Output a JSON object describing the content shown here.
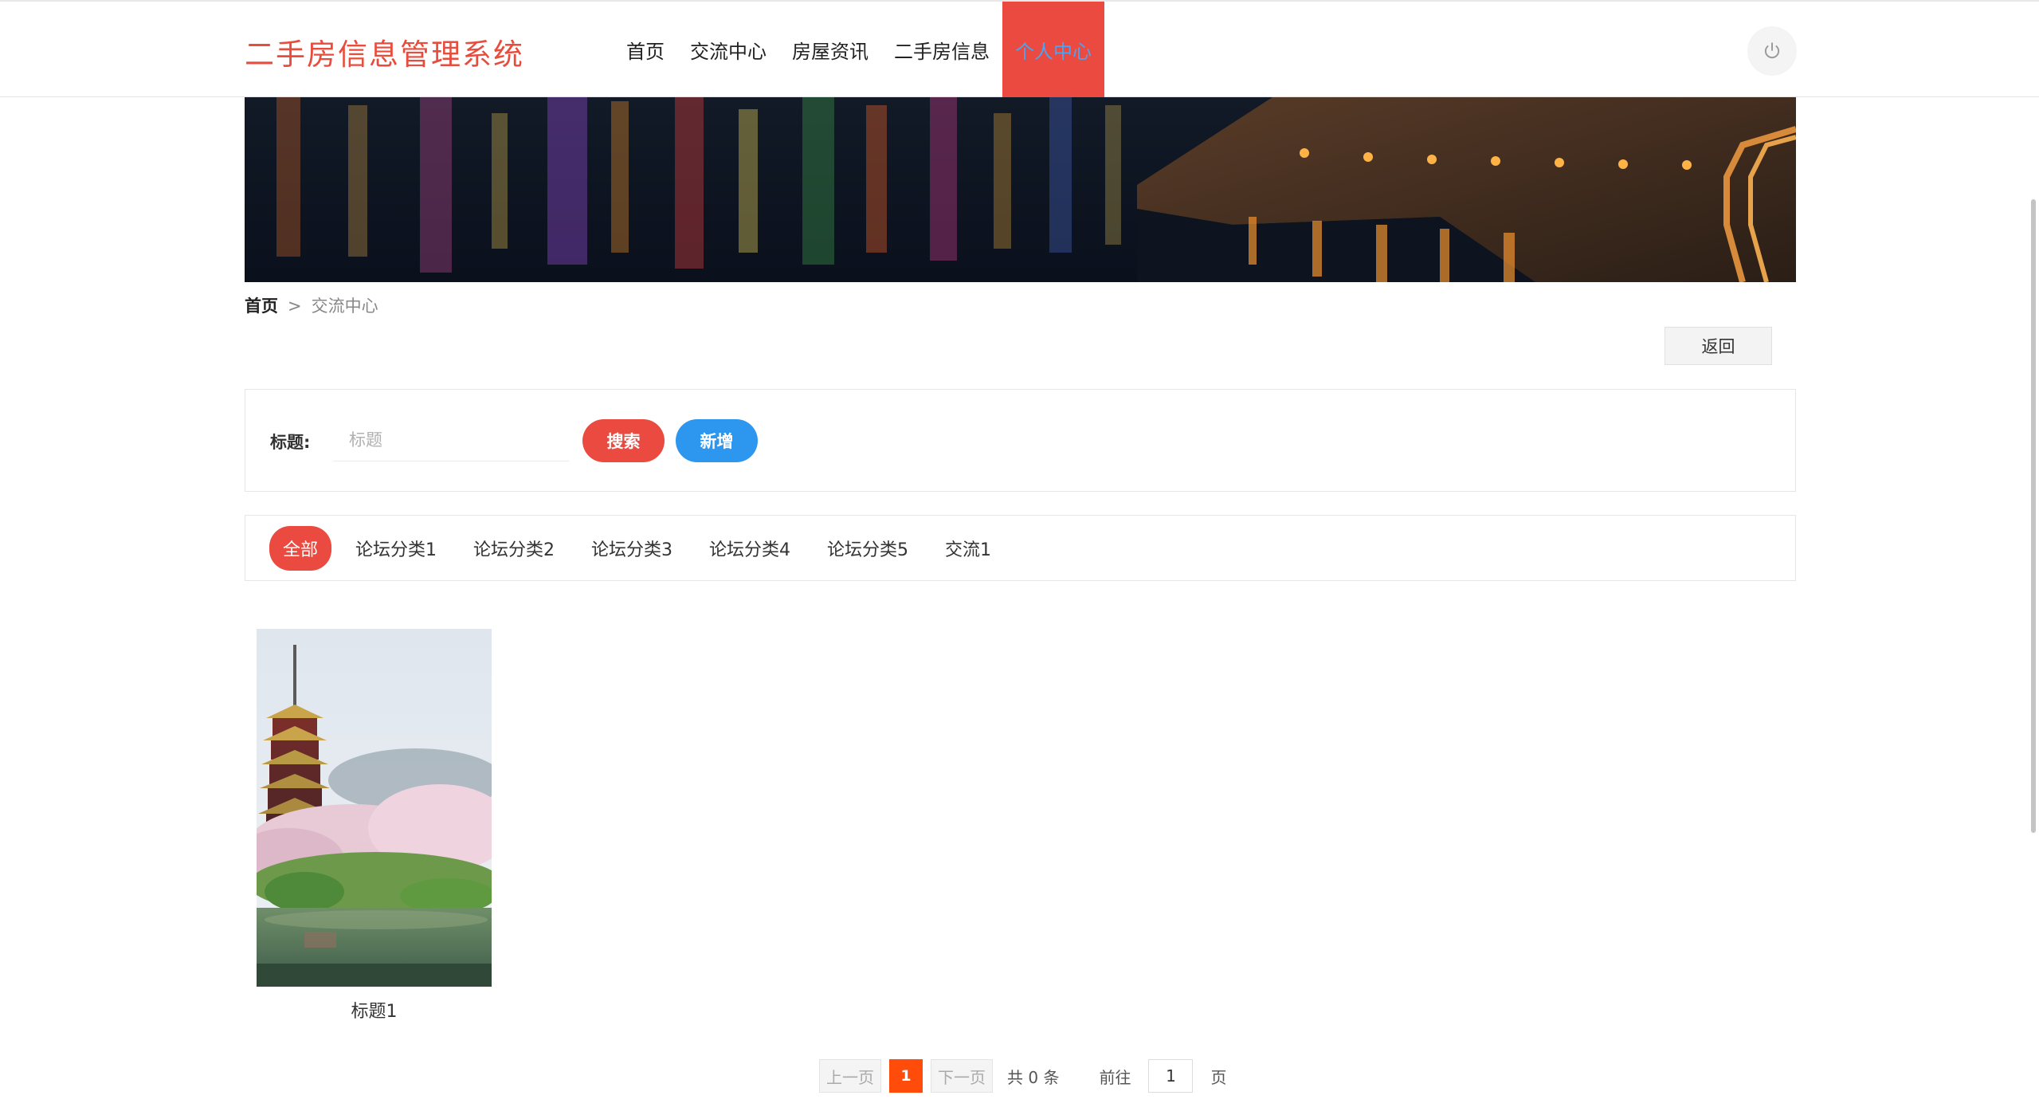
{
  "app": {
    "title": "二手房信息管理系统"
  },
  "nav": {
    "items": [
      {
        "label": "首页",
        "active": false
      },
      {
        "label": "交流中心",
        "active": false
      },
      {
        "label": "房屋资讯",
        "active": false
      },
      {
        "label": "二手房信息",
        "active": false
      },
      {
        "label": "个人中心",
        "active": true
      }
    ]
  },
  "header": {
    "power_icon": "power-icon"
  },
  "breadcrumb": {
    "home": "首页",
    "separator": ">",
    "current": "交流中心"
  },
  "actions": {
    "back_label": "返回"
  },
  "search": {
    "label": "标题:",
    "placeholder": "标题",
    "search_label": "搜索",
    "add_label": "新增"
  },
  "categories": [
    {
      "label": "全部",
      "active": true
    },
    {
      "label": "论坛分类1",
      "active": false
    },
    {
      "label": "论坛分类2",
      "active": false
    },
    {
      "label": "论坛分类3",
      "active": false
    },
    {
      "label": "论坛分类4",
      "active": false
    },
    {
      "label": "论坛分类5",
      "active": false
    },
    {
      "label": "交流1",
      "active": false
    }
  ],
  "posts": [
    {
      "title": "标题1"
    }
  ],
  "pagination": {
    "prev": "上一页",
    "current": "1",
    "next": "下一页",
    "total": "共 0 条",
    "goto": "前往",
    "goto_value": "1",
    "page_unit": "页"
  },
  "colors": {
    "brand": "#e84c3d",
    "active_nav_bg": "#ea4a3f",
    "search_button": "#ea4a3f",
    "add_button": "#2d96ef",
    "page_active": "#ff4c0a"
  }
}
